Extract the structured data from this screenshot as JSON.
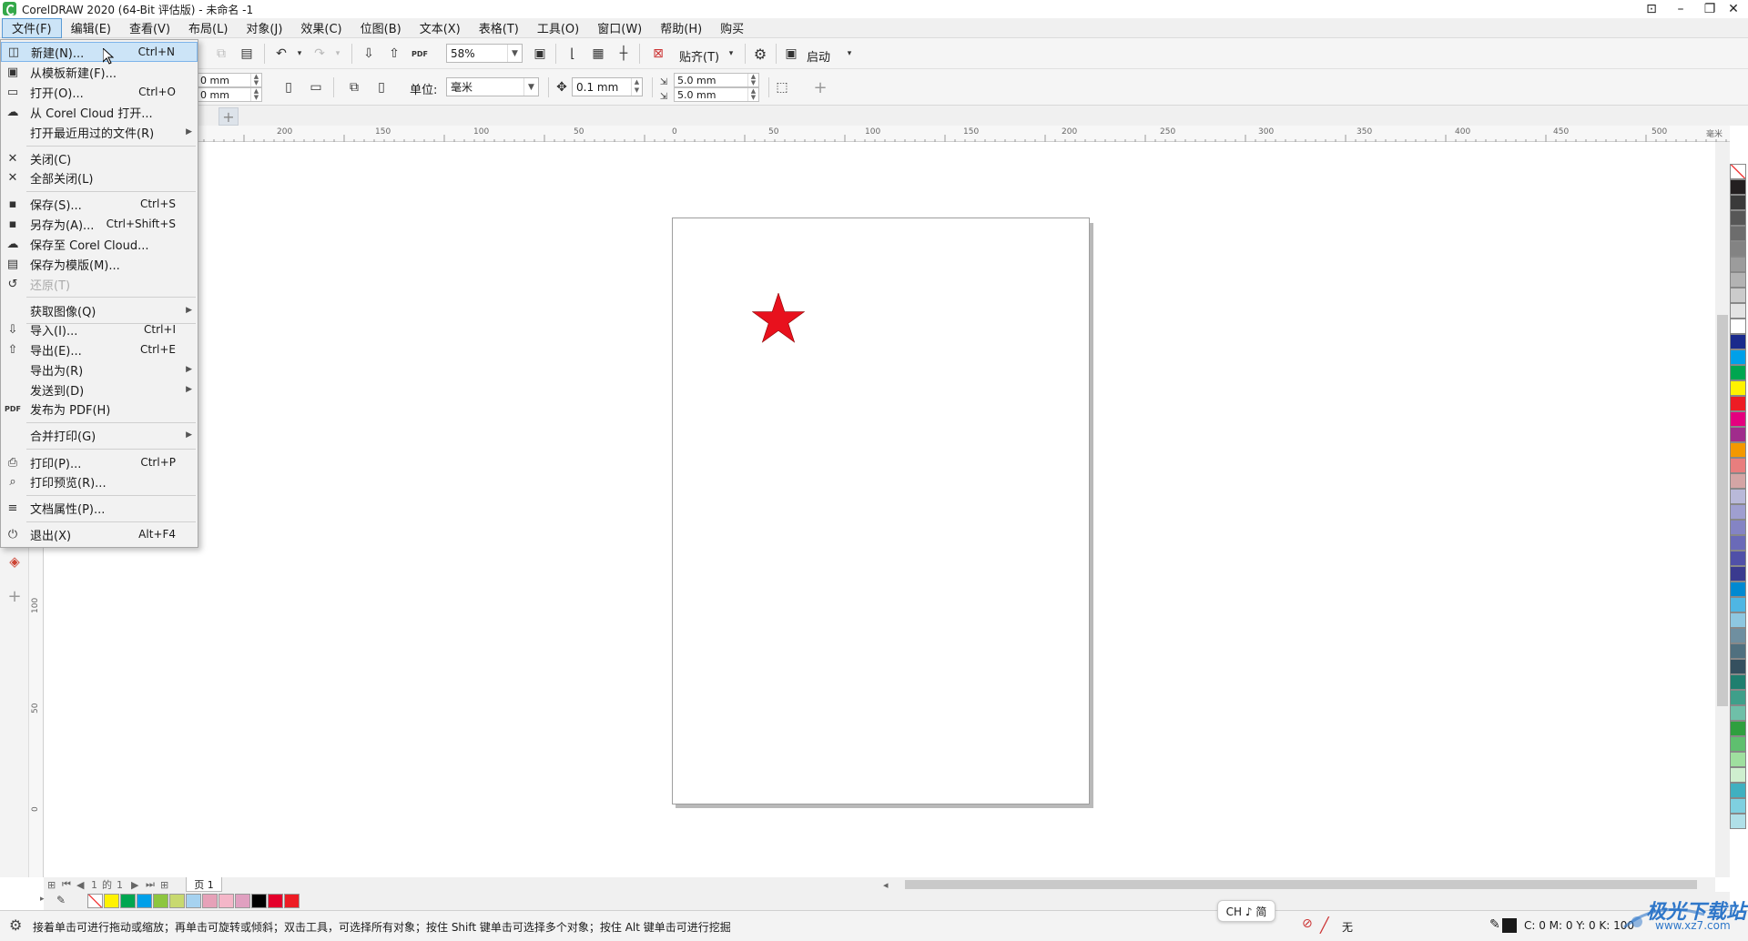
{
  "window": {
    "title": "CorelDRAW 2020 (64-Bit 评估版) - 未命名 -1",
    "controls": {
      "account": "⊡",
      "minimize": "–",
      "maximize": "❐",
      "close": "✕"
    }
  },
  "menubar": [
    "文件(F)",
    "编辑(E)",
    "查看(V)",
    "布局(L)",
    "对象(J)",
    "效果(C)",
    "位图(B)",
    "文本(X)",
    "表格(T)",
    "工具(O)",
    "窗口(W)",
    "帮助(H)",
    "购买"
  ],
  "toolbar1": {
    "zoom": "58%",
    "snap_label": "贴齐(T)",
    "launch_label": "启动"
  },
  "toolbar2": {
    "width_value": "0 mm",
    "height_value": "0 mm",
    "units_label": "单位:",
    "units_value": "毫米",
    "nudge_value": "0.1 mm",
    "dup_x": "5.0 mm",
    "dup_y": "5.0 mm"
  },
  "ruler": {
    "h_labels": [
      "200",
      "150",
      "100",
      "50",
      "0",
      "50",
      "100",
      "150",
      "200",
      "250",
      "300",
      "350",
      "400",
      "450",
      "500"
    ],
    "h_unit": "毫米",
    "v_labels": [
      "100",
      "50",
      "0"
    ]
  },
  "file_menu": {
    "items": [
      {
        "label": "新建(N)...",
        "shortcut": "Ctrl+N",
        "icon": "new-doc-icon",
        "glyph": "◫"
      },
      {
        "label": "从模板新建(F)...",
        "shortcut": "",
        "icon": "template-icon",
        "glyph": "▣"
      },
      {
        "label": "打开(O)...",
        "shortcut": "Ctrl+O",
        "icon": "folder-open-icon",
        "glyph": "▭"
      },
      {
        "label": "从 Corel Cloud 打开...",
        "shortcut": "",
        "icon": "cloud-download-icon",
        "glyph": "☁"
      },
      {
        "label": "打开最近用过的文件(R)",
        "shortcut": "",
        "icon": "",
        "glyph": ""
      },
      {
        "label": "关闭(C)",
        "shortcut": "",
        "icon": "close-doc-icon",
        "glyph": "✕"
      },
      {
        "label": "全部关闭(L)",
        "shortcut": "",
        "icon": "close-all-icon",
        "glyph": "✕"
      },
      {
        "label": "保存(S)...",
        "shortcut": "Ctrl+S",
        "icon": "save-icon",
        "glyph": "▪"
      },
      {
        "label": "另存为(A)...",
        "shortcut": "Ctrl+Shift+S",
        "icon": "save-as-icon",
        "glyph": "▪"
      },
      {
        "label": "保存至 Corel Cloud...",
        "shortcut": "",
        "icon": "cloud-upload-icon",
        "glyph": "☁"
      },
      {
        "label": "保存为模版(M)...",
        "shortcut": "",
        "icon": "save-template-icon",
        "glyph": "▤"
      },
      {
        "label": "还原(T)",
        "shortcut": "",
        "icon": "revert-icon",
        "glyph": "↺"
      },
      {
        "label": "获取图像(Q)",
        "shortcut": "",
        "icon": "",
        "glyph": ""
      },
      {
        "label": "导入(I)...",
        "shortcut": "Ctrl+I",
        "icon": "import-icon",
        "glyph": "⇩"
      },
      {
        "label": "导出(E)...",
        "shortcut": "Ctrl+E",
        "icon": "export-icon",
        "glyph": "⇧"
      },
      {
        "label": "导出为(R)",
        "shortcut": "",
        "icon": "",
        "glyph": ""
      },
      {
        "label": "发送到(D)",
        "shortcut": "",
        "icon": "",
        "glyph": ""
      },
      {
        "label": "发布为 PDF(H)",
        "shortcut": "",
        "icon": "pdf-icon",
        "glyph": "PDF"
      },
      {
        "label": "合并打印(G)",
        "shortcut": "",
        "icon": "",
        "glyph": ""
      },
      {
        "label": "打印(P)...",
        "shortcut": "Ctrl+P",
        "icon": "print-icon",
        "glyph": "⎙"
      },
      {
        "label": "打印预览(R)...",
        "shortcut": "",
        "icon": "print-preview-icon",
        "glyph": "⌕"
      },
      {
        "label": "文档属性(P)...",
        "shortcut": "",
        "icon": "doc-properties-icon",
        "glyph": "≡"
      },
      {
        "label": "退出(X)",
        "shortcut": "Alt+F4",
        "icon": "exit-icon",
        "glyph": "⏻"
      }
    ]
  },
  "page_nav": {
    "counter_a": "1",
    "counter_of": "的",
    "counter_b": "1",
    "page_tab": "页 1"
  },
  "status": {
    "hint": "接着单击可进行拖动或缩放；再单击可旋转或倾斜；双击工具，可选择所有对象；按住 Shift 键单击可选择多个对象；按住 Alt 键单击可进行挖掘",
    "ime": "CH ♪ 简",
    "fill_none": "无",
    "cmyk": "C: 0 M: 0 Y: 0 K: 100"
  },
  "colors": {
    "star": "#e8111d",
    "menu_highlight": "#cce4f7",
    "palette": [
      "#ffffff",
      "#231f20",
      "#3a3a3a",
      "#575757",
      "#6d6d6d",
      "#838383",
      "#9c9c9c",
      "#b3b3b3",
      "#cbcbcb",
      "#e3e3e3",
      "#ffffff",
      "#1a2a8c",
      "#00a0e9",
      "#00a650",
      "#fff200",
      "#ed1c24",
      "#e4007f",
      "#a02c8c",
      "#f39800",
      "#e87e7e",
      "#d4a5a5",
      "#b9b9d9",
      "#9f9fd0",
      "#8484c4",
      "#6a6ab8",
      "#5050a8",
      "#3a3a8f",
      "#0089d1",
      "#4fb6e3",
      "#8ec7e0",
      "#6f8fa0",
      "#50707f",
      "#35505f",
      "#1f7f6f",
      "#3f9f8a",
      "#6fbfa8",
      "#2f9f3f",
      "#5fbf6f",
      "#9fdf9f",
      "#cfefcf",
      "#40b0c0",
      "#7fd0e0",
      "#b0e0e8"
    ],
    "doc_palette": [
      "#ffffff",
      "#fff200",
      "#00a650",
      "#00a0e9",
      "#8dc63f",
      "#c8d96f",
      "#a6d2f0",
      "#e6a1b8",
      "#f4b6c8",
      "#e0a0c0",
      "#000000",
      "#e4002b",
      "#ed1c24"
    ]
  },
  "watermark": {
    "name": "极光下载站",
    "url": "www.xz7.com"
  }
}
